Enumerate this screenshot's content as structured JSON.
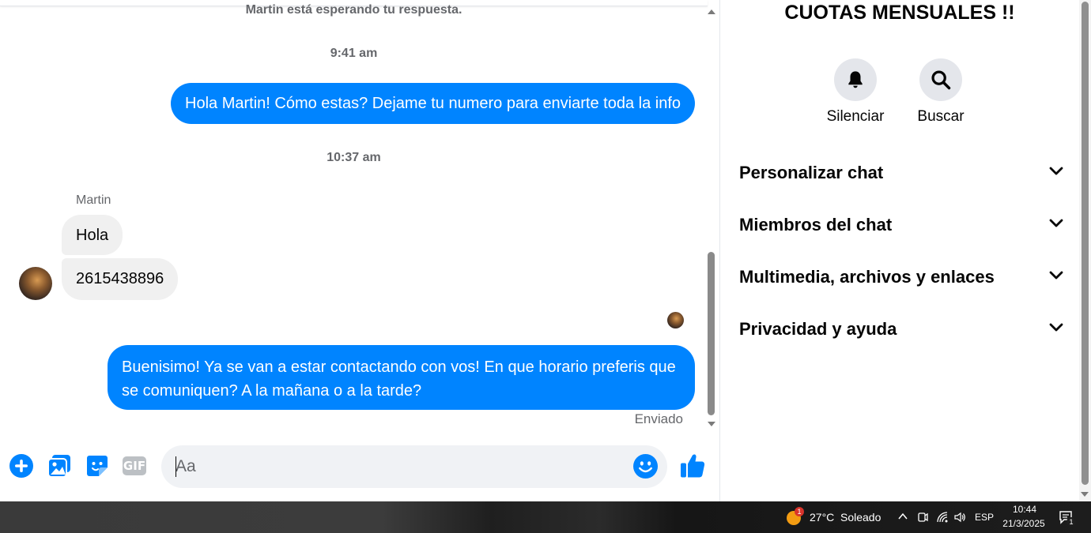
{
  "chat": {
    "waiting_notice": "Martin está esperando tu respuesta.",
    "timestamps": [
      "9:41 am",
      "10:37 am"
    ],
    "messages": [
      {
        "direction": "outgoing",
        "text": "Hola Martin! Cómo estas? Dejame tu numero para enviarte toda la info"
      },
      {
        "direction": "incoming",
        "sender": "Martin",
        "text": "Hola"
      },
      {
        "direction": "incoming",
        "sender": "Martin",
        "text": "2615438896"
      },
      {
        "direction": "outgoing",
        "text": "Buenisimo! Ya se van a estar contactando con vos! En que horario preferis que se comuniquen? A la mañana o a la tarde?"
      }
    ],
    "sender_name": "Martin",
    "status": "Enviado"
  },
  "composer": {
    "placeholder": "Aa",
    "gif_label": "GIF",
    "icons": [
      "plus-icon",
      "image-icon",
      "sticker-icon",
      "gif-icon",
      "emoji-icon",
      "like-icon"
    ]
  },
  "info": {
    "title": "CUOTAS MENSUALES !!",
    "actions": [
      {
        "label": "Silenciar",
        "icon": "bell-icon"
      },
      {
        "label": "Buscar",
        "icon": "search-icon"
      }
    ],
    "sections": [
      {
        "label": "Personalizar chat"
      },
      {
        "label": "Miembros del chat"
      },
      {
        "label": "Multimedia, archivos y enlaces"
      },
      {
        "label": "Privacidad y ayuda"
      }
    ]
  },
  "taskbar": {
    "weather_temp": "27°C",
    "weather_desc": "Soleado",
    "weather_badge": "1",
    "language": "ESP",
    "time": "10:44",
    "date": "21/3/2025",
    "notification_count": "1"
  },
  "colors": {
    "accent": "#0084ff",
    "incoming_bubble": "#f0f0f0",
    "muted_text": "#65676b"
  }
}
